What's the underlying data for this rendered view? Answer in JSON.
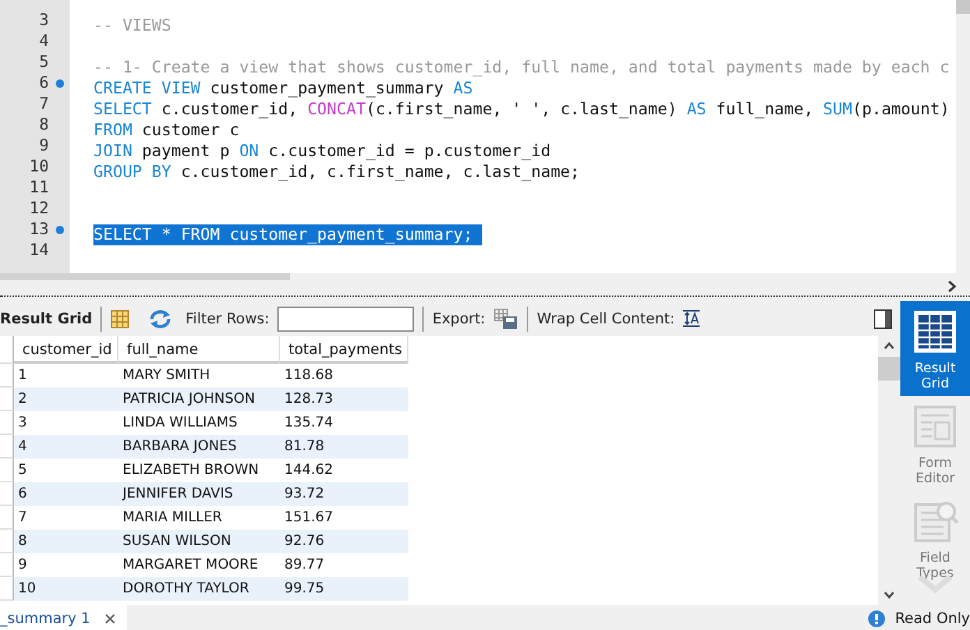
{
  "editor": {
    "lines": [
      {
        "number": "3",
        "marker": false,
        "selected": false,
        "tokens": [
          {
            "kind": "comment",
            "text": "-- VIEWS"
          }
        ]
      },
      {
        "number": "4",
        "marker": false,
        "selected": false
      },
      {
        "number": "5",
        "marker": false,
        "selected": false,
        "tokens": [
          {
            "kind": "comment",
            "text": "-- 1- Create a view that shows customer_id, full name, and total payments made by each c"
          }
        ]
      },
      {
        "number": "6",
        "marker": true,
        "selected": false,
        "tokens": [
          {
            "kind": "keyword",
            "text": "CREATE VIEW"
          },
          {
            "kind": "plain",
            "text": " customer_payment_summary "
          },
          {
            "kind": "keyword",
            "text": "AS"
          }
        ]
      },
      {
        "number": "7",
        "marker": false,
        "selected": false,
        "tokens": [
          {
            "kind": "keyword",
            "text": "SELECT"
          },
          {
            "kind": "plain",
            "text": " c.customer_id, "
          },
          {
            "kind": "function",
            "text": "CONCAT"
          },
          {
            "kind": "plain",
            "text": "(c.first_name, ' ', c.last_name) "
          },
          {
            "kind": "keyword",
            "text": "AS"
          },
          {
            "kind": "plain",
            "text": " full_name, "
          },
          {
            "kind": "keyword",
            "text": "SUM"
          },
          {
            "kind": "plain",
            "text": "(p.amount)"
          }
        ]
      },
      {
        "number": "8",
        "marker": false,
        "selected": false,
        "tokens": [
          {
            "kind": "keyword",
            "text": "FROM"
          },
          {
            "kind": "plain",
            "text": " customer c"
          }
        ]
      },
      {
        "number": "9",
        "marker": false,
        "selected": false,
        "tokens": [
          {
            "kind": "keyword",
            "text": "JOIN"
          },
          {
            "kind": "plain",
            "text": " payment p "
          },
          {
            "kind": "keyword",
            "text": "ON"
          },
          {
            "kind": "plain",
            "text": " c.customer_id = p.customer_id"
          }
        ]
      },
      {
        "number": "10",
        "marker": false,
        "selected": false,
        "tokens": [
          {
            "kind": "keyword",
            "text": "GROUP BY"
          },
          {
            "kind": "plain",
            "text": " c.customer_id, c.first_name, c.last_name;"
          }
        ]
      },
      {
        "number": "11",
        "marker": false,
        "selected": false
      },
      {
        "number": "12",
        "marker": false,
        "selected": false
      },
      {
        "number": "13",
        "marker": true,
        "selected": true,
        "tokens": [
          {
            "kind": "plain",
            "text": "SELECT * FROM customer_payment_summary; "
          }
        ]
      },
      {
        "number": "14",
        "marker": false,
        "selected": false
      }
    ]
  },
  "results_toolbar": {
    "view_label": "Result Grid",
    "filter_label": "Filter Rows:",
    "export_label": "Export:",
    "wrap_label": "Wrap Cell Content:"
  },
  "table": {
    "columns": [
      "customer_id",
      "full_name",
      "total_payments"
    ],
    "rows": [
      [
        "1",
        "MARY SMITH",
        "118.68"
      ],
      [
        "2",
        "PATRICIA JOHNSON",
        "128.73"
      ],
      [
        "3",
        "LINDA WILLIAMS",
        "135.74"
      ],
      [
        "4",
        "BARBARA JONES",
        "81.78"
      ],
      [
        "5",
        "ELIZABETH BROWN",
        "144.62"
      ],
      [
        "6",
        "JENNIFER DAVIS",
        "93.72"
      ],
      [
        "7",
        "MARIA MILLER",
        "151.67"
      ],
      [
        "8",
        "SUSAN WILSON",
        "92.76"
      ],
      [
        "9",
        "MARGARET MOORE",
        "89.77"
      ],
      [
        "10",
        "DOROTHY TAYLOR",
        "99.75"
      ]
    ]
  },
  "side_panel": {
    "items": [
      {
        "label": "Result Grid",
        "selected": true
      },
      {
        "label": "Form Editor",
        "selected": false
      },
      {
        "label": "Field Types",
        "selected": false
      }
    ]
  },
  "result_tab": {
    "label": "_summary 1"
  },
  "status": {
    "text": "Read Only"
  }
}
